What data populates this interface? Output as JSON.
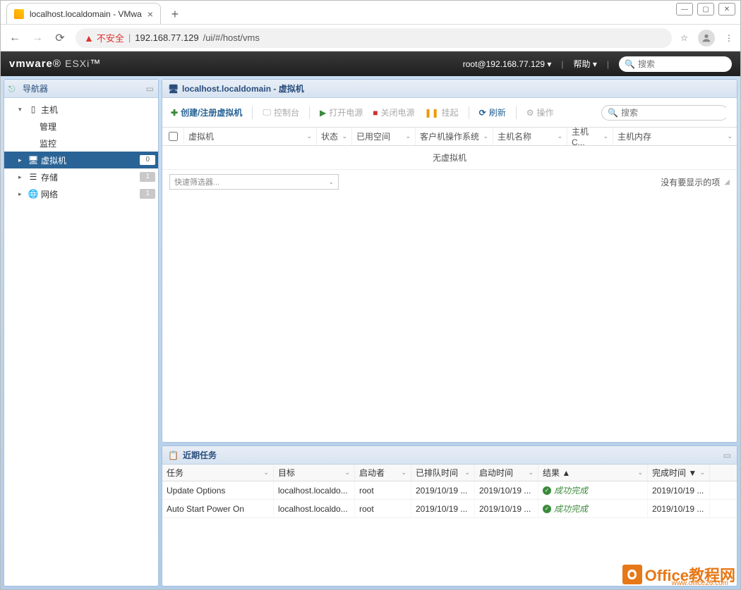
{
  "browser": {
    "tab_title": "localhost.localdomain - VMwa",
    "url_warning": "不安全",
    "url_host": "192.168.77.129",
    "url_path": "/ui/#/host/vms"
  },
  "header": {
    "logo_brand": "vmware",
    "logo_product": "ESXi",
    "user": "root@192.168.77.129",
    "help": "帮助",
    "search_placeholder": "搜索"
  },
  "navigator": {
    "title": "导航器",
    "host": "主机",
    "host_manage": "管理",
    "host_monitor": "监控",
    "vms": "虚拟机",
    "vms_badge": "0",
    "storage": "存储",
    "storage_badge": "1",
    "network": "网络",
    "network_badge": "1"
  },
  "vm_panel": {
    "title": "localhost.localdomain - 虚拟机",
    "toolbar": {
      "create": "创建/注册虚拟机",
      "console": "控制台",
      "power_on": "打开电源",
      "power_off": "关闭电源",
      "suspend": "挂起",
      "refresh": "刷新",
      "actions": "操作",
      "search_placeholder": "搜索"
    },
    "columns": {
      "vm": "虚拟机",
      "status": "状态",
      "used_space": "已用空间",
      "guest_os": "客户机操作系统",
      "host_name": "主机名称",
      "host_cpu": "主机 C...",
      "host_mem": "主机内存"
    },
    "empty_text": "无虚拟机",
    "quick_filter": "快速筛选器...",
    "no_items": "没有要显示的项"
  },
  "tasks": {
    "title": "近期任务",
    "columns": {
      "task": "任务",
      "target": "目标",
      "initiator": "启动者",
      "queued": "已排队时间",
      "start": "启动时间",
      "result": "结果 ▲",
      "done": "完成时间 ▼"
    },
    "rows": [
      {
        "task": "Update Options",
        "target": "localhost.localdo...",
        "initiator": "root",
        "queued": "2019/10/19 ...",
        "start": "2019/10/19 ...",
        "result": "成功完成",
        "done": "2019/10/19 ..."
      },
      {
        "task": "Auto Start Power On",
        "target": "localhost.localdo...",
        "initiator": "root",
        "queued": "2019/10/19 ...",
        "start": "2019/10/19 ...",
        "result": "成功完成",
        "done": "2019/10/19 ..."
      }
    ]
  },
  "watermark": {
    "text": "Office教程网",
    "sub": "www.office26.com"
  }
}
